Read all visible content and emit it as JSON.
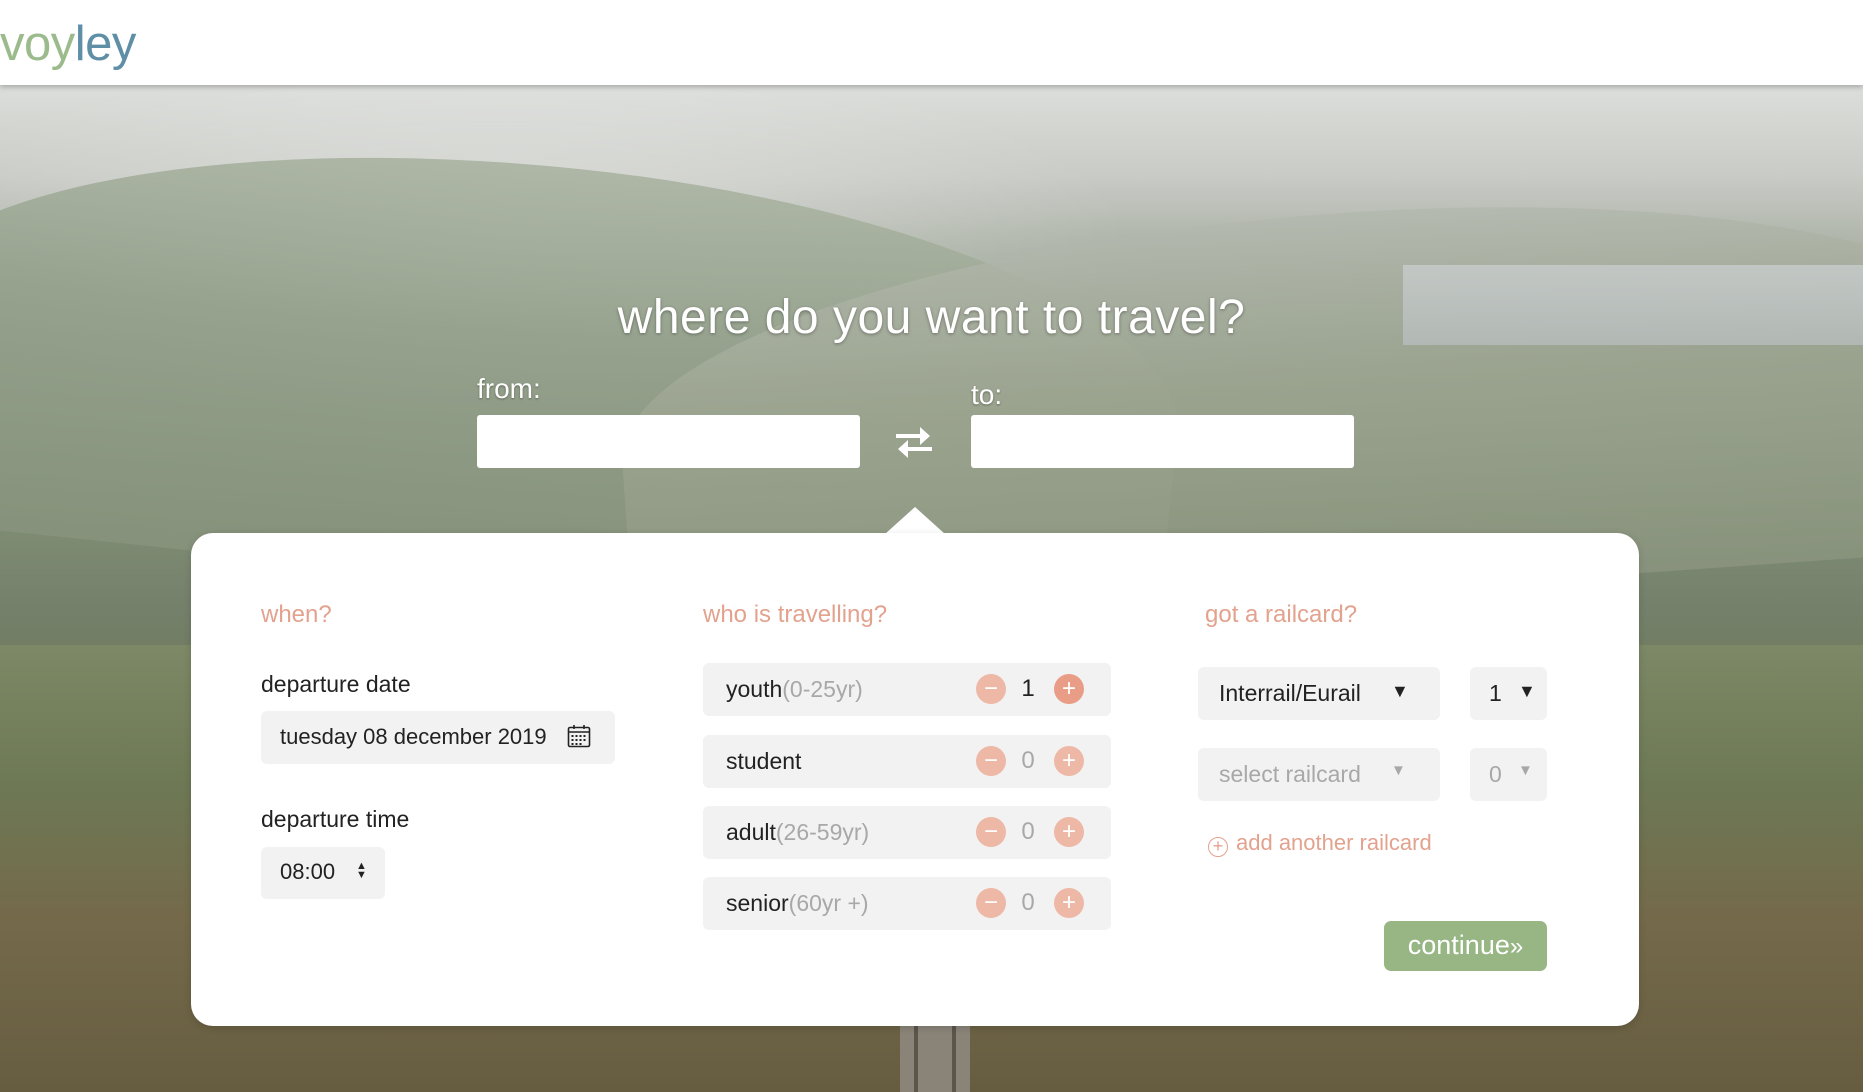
{
  "brand": {
    "logo_part1": "voy",
    "logo_part2": "ley"
  },
  "hero": {
    "headline": "where do you want to travel?",
    "from_label": "from:",
    "to_label": "to:",
    "from_value": "",
    "to_value": ""
  },
  "when": {
    "heading": "when?",
    "date_label": "departure date",
    "date_value": "tuesday 08 december 2019",
    "time_label": "departure time",
    "time_value": "08:00"
  },
  "who": {
    "heading": "who is travelling?",
    "passengers": [
      {
        "name": "youth",
        "age": "(0-25yr)",
        "count": "1"
      },
      {
        "name": "student",
        "age": "",
        "count": "0"
      },
      {
        "name": "adult",
        "age": "(26-59yr)",
        "count": "0"
      },
      {
        "name": "senior",
        "age": "(60yr +)",
        "count": "0"
      }
    ],
    "minus_symbol": "−",
    "plus_symbol": "+"
  },
  "railcard": {
    "heading": "got a railcard?",
    "rows": [
      {
        "card": "Interrail/Eurail",
        "qty": "1"
      },
      {
        "card": "select railcard",
        "qty": "0"
      }
    ],
    "add_label": "add another railcard",
    "add_symbol": "+",
    "arrow_symbol": "▼"
  },
  "actions": {
    "continue_label": "continue",
    "continue_symbol": "»"
  },
  "colors": {
    "accent": "#e3a28e",
    "brand_green": "#97b684",
    "brand_blue": "#5f8fa6",
    "panel_bg": "#ffffff"
  }
}
